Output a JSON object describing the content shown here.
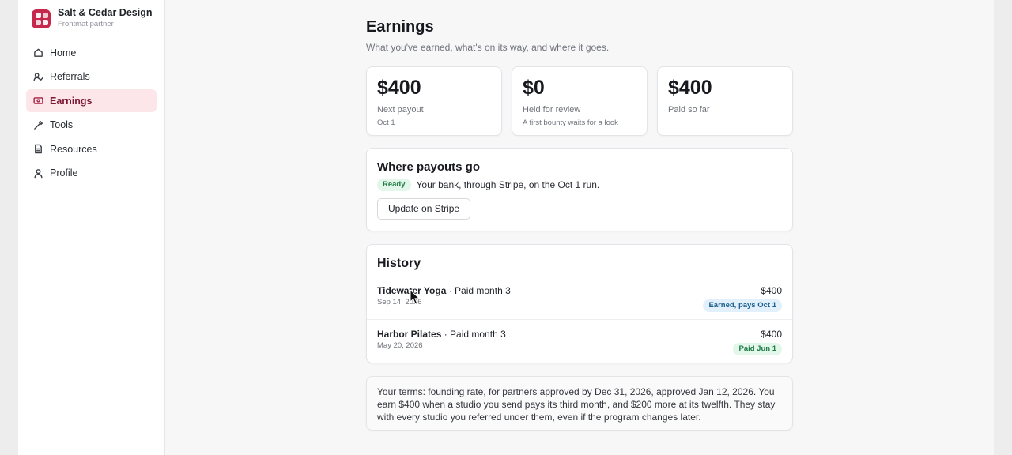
{
  "brand": {
    "name": "Salt & Cedar Design",
    "subtitle": "Frontmat partner"
  },
  "sidebar": {
    "items": [
      {
        "label": "Home",
        "icon": "home-icon",
        "active": false
      },
      {
        "label": "Referrals",
        "icon": "referrals-icon",
        "active": false
      },
      {
        "label": "Earnings",
        "icon": "earnings-icon",
        "active": true
      },
      {
        "label": "Tools",
        "icon": "tools-icon",
        "active": false
      },
      {
        "label": "Resources",
        "icon": "document-icon",
        "active": false
      },
      {
        "label": "Profile",
        "icon": "user-icon",
        "active": false
      }
    ]
  },
  "page": {
    "title": "Earnings",
    "subtitle": "What you've earned, what's on its way, and where it goes."
  },
  "stats": [
    {
      "value": "$400",
      "label": "Next payout",
      "note": "Oct 1"
    },
    {
      "value": "$0",
      "label": "Held for review",
      "note": "A first bounty waits for a look"
    },
    {
      "value": "$400",
      "label": "Paid so far",
      "note": ""
    }
  ],
  "payouts": {
    "title": "Where payouts go",
    "status": "Ready",
    "text": "Your bank, through Stripe, on the Oct 1 run.",
    "button": "Update on Stripe"
  },
  "history": {
    "title": "History",
    "rows": [
      {
        "studio": "Tidewater Yoga",
        "event": " · Paid month 3",
        "date": "Sep 14, 2026",
        "amount": "$400",
        "status": "Earned, pays Oct 1",
        "status_kind": "blue"
      },
      {
        "studio": "Harbor Pilates",
        "event": " · Paid month 3",
        "date": "May 20, 2026",
        "amount": "$400",
        "status": "Paid Jun 1",
        "status_kind": "green"
      }
    ]
  },
  "terms": "Your terms: founding rate, for partners approved by Dec 31, 2026, approved Jan 12, 2026. You earn $400 when a studio you send pays its third month, and $200 more at its twelfth. They stay with every studio you referred under them, even if the program changes later.",
  "colors": {
    "brand": "#c6284b",
    "active_nav_bg": "#fde6ea",
    "ready_badge_bg": "#e2f6e9",
    "earned_badge_bg": "#e1f0fb"
  }
}
